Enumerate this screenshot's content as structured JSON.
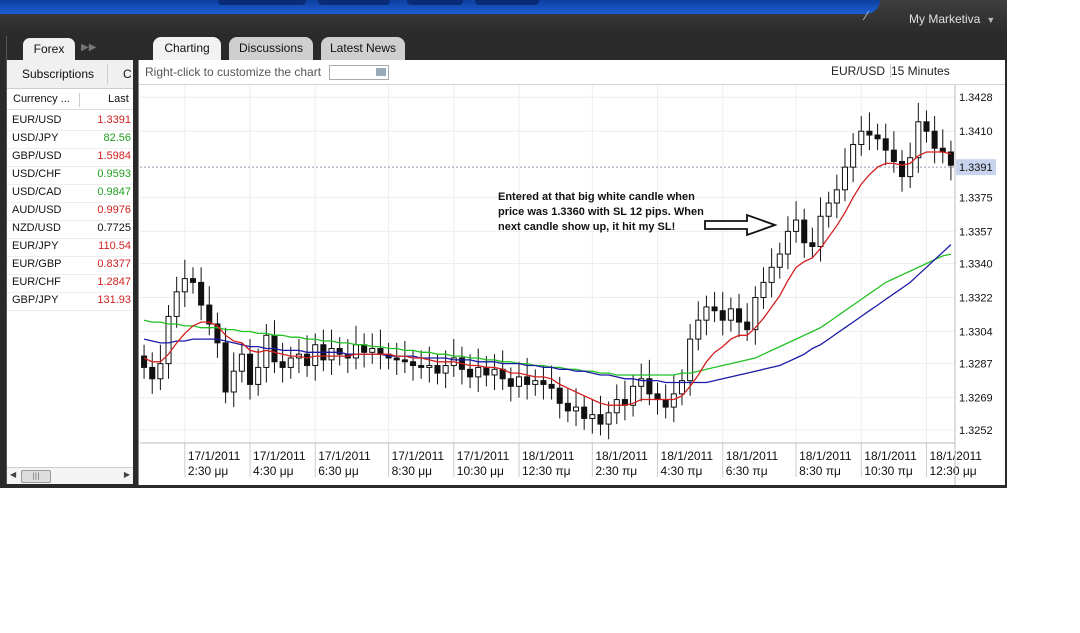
{
  "header": {
    "account_label": "My Marketiva"
  },
  "left_panel": {
    "tab_label": "Forex",
    "subscriptions_label": "Subscriptions",
    "subscriptions_more": "C",
    "col_currency": "Currency ...",
    "col_last": "Last",
    "rows": [
      {
        "pair": "EUR/USD",
        "last": "1.3391",
        "color": "#d42020"
      },
      {
        "pair": "USD/JPY",
        "last": "82.56",
        "color": "#22a022"
      },
      {
        "pair": "GBP/USD",
        "last": "1.5984",
        "color": "#d42020"
      },
      {
        "pair": "USD/CHF",
        "last": "0.9593",
        "color": "#22a022"
      },
      {
        "pair": "USD/CAD",
        "last": "0.9847",
        "color": "#22a022"
      },
      {
        "pair": "AUD/USD",
        "last": "0.9976",
        "color": "#d42020"
      },
      {
        "pair": "NZD/USD",
        "last": "0.7725",
        "color": "#111111"
      },
      {
        "pair": "EUR/JPY",
        "last": "110.54",
        "color": "#d42020"
      },
      {
        "pair": "EUR/GBP",
        "last": "0.8377",
        "color": "#d42020"
      },
      {
        "pair": "EUR/CHF",
        "last": "1.2847",
        "color": "#d42020"
      },
      {
        "pair": "GBP/JPY",
        "last": "131.93",
        "color": "#d42020"
      }
    ]
  },
  "main_tabs": [
    "Charting",
    "Discussions",
    "Latest News"
  ],
  "chart_toolbar": {
    "hint": "Right-click to customize the chart",
    "symbol": "EUR/USD",
    "timeframe": "15 Minutes"
  },
  "annotation": "Entered at that big white candle when price was 1.3360 with SL 12 pips. When next candle show up, it hit my SL!",
  "chart_data": {
    "type": "candlestick",
    "symbol": "EUR/USD",
    "timeframe": "15 Minutes",
    "current_price": 1.3391,
    "y_ticks": [
      "1.3428",
      "1.3410",
      "1.3375",
      "1.3357",
      "1.3340",
      "1.3322",
      "1.3304",
      "1.3287",
      "1.3269",
      "1.3252"
    ],
    "x_ticks": [
      {
        "date": "17/1/2011",
        "time": "2:30 μμ"
      },
      {
        "date": "17/1/2011",
        "time": "4:30 μμ"
      },
      {
        "date": "17/1/2011",
        "time": "6:30 μμ"
      },
      {
        "date": "17/1/2011",
        "time": "8:30 μμ"
      },
      {
        "date": "17/1/2011",
        "time": "10:30 μμ"
      },
      {
        "date": "18/1/2011",
        "time": "12:30 πμ"
      },
      {
        "date": "18/1/2011",
        "time": "2:30 πμ"
      },
      {
        "date": "18/1/2011",
        "time": "4:30 πμ"
      },
      {
        "date": "18/1/2011",
        "time": "6:30 πμ"
      },
      {
        "date": "18/1/2011",
        "time": "8:30 πμ"
      },
      {
        "date": "18/1/2011",
        "time": "10:30 πμ"
      },
      {
        "date": "18/1/2011",
        "time": "12:30 μμ"
      }
    ],
    "ylim": [
      1.3245,
      1.3435
    ],
    "close": [
      1.3285,
      1.3279,
      1.3287,
      1.3312,
      1.3325,
      1.3332,
      1.333,
      1.3318,
      1.3308,
      1.3298,
      1.3272,
      1.3283,
      1.3292,
      1.3276,
      1.3285,
      1.3302,
      1.3288,
      1.3285,
      1.329,
      1.3292,
      1.3286,
      1.3297,
      1.3289,
      1.3295,
      1.3292,
      1.329,
      1.3297,
      1.3293,
      1.3295,
      1.3292,
      1.329,
      1.3289,
      1.3288,
      1.3286,
      1.3285,
      1.3286,
      1.3282,
      1.3286,
      1.329,
      1.3284,
      1.328,
      1.3285,
      1.3281,
      1.3284,
      1.3279,
      1.3275,
      1.328,
      1.3276,
      1.3278,
      1.3276,
      1.3274,
      1.3266,
      1.3262,
      1.3264,
      1.3258,
      1.326,
      1.3255,
      1.3261,
      1.3268,
      1.3265,
      1.3275,
      1.3279,
      1.3271,
      1.3268,
      1.3264,
      1.3271,
      1.3278,
      1.33,
      1.331,
      1.3317,
      1.3315,
      1.331,
      1.3316,
      1.3309,
      1.3305,
      1.3322,
      1.333,
      1.3338,
      1.3345,
      1.3357,
      1.3363,
      1.3351,
      1.3349,
      1.3365,
      1.3372,
      1.3379,
      1.3391,
      1.3403,
      1.341,
      1.3408,
      1.3406,
      1.34,
      1.3394,
      1.3386,
      1.3396,
      1.3415,
      1.341,
      1.3401,
      1.3399,
      1.3392
    ],
    "ema_red": [
      1.329,
      1.3288,
      1.3288,
      1.3292,
      1.3298,
      1.3303,
      1.3307,
      1.3309,
      1.3309,
      1.3307,
      1.3302,
      1.3299,
      1.3298,
      1.3294,
      1.3293,
      1.3294,
      1.3293,
      1.3292,
      1.3291,
      1.3291,
      1.329,
      1.3291,
      1.3291,
      1.3291,
      1.3291,
      1.3291,
      1.3292,
      1.3292,
      1.3292,
      1.3292,
      1.3292,
      1.3291,
      1.3291,
      1.329,
      1.329,
      1.3289,
      1.3288,
      1.3288,
      1.3288,
      1.3287,
      1.3286,
      1.3286,
      1.3285,
      1.3285,
      1.3284,
      1.3282,
      1.3282,
      1.3281,
      1.328,
      1.328,
      1.3279,
      1.3276,
      1.3274,
      1.3272,
      1.327,
      1.3268,
      1.3266,
      1.3265,
      1.3265,
      1.3265,
      1.3266,
      1.3268,
      1.3268,
      1.3268,
      1.3268,
      1.3268,
      1.327,
      1.3275,
      1.3281,
      1.3288,
      1.3293,
      1.3296,
      1.33,
      1.3302,
      1.3302,
      1.3306,
      1.3311,
      1.3317,
      1.3323,
      1.3331,
      1.3338,
      1.3341,
      1.3343,
      1.3348,
      1.3354,
      1.336,
      1.3367,
      1.3375,
      1.3382,
      1.3387,
      1.3391,
      1.3393,
      1.3393,
      1.3392,
      1.3393,
      1.3397,
      1.3399,
      1.3399,
      1.3399,
      1.3398
    ],
    "sma_blue": [
      1.33,
      1.3299,
      1.3298,
      1.3298,
      1.3299,
      1.3299,
      1.33,
      1.33,
      1.33,
      1.33,
      1.3299,
      1.3298,
      1.3297,
      1.3296,
      1.3296,
      1.3295,
      1.3295,
      1.3294,
      1.3294,
      1.3294,
      1.3293,
      1.3293,
      1.3293,
      1.3293,
      1.3293,
      1.3292,
      1.3292,
      1.3292,
      1.3292,
      1.3292,
      1.3291,
      1.3291,
      1.3291,
      1.3291,
      1.329,
      1.329,
      1.329,
      1.329,
      1.3289,
      1.3289,
      1.3289,
      1.3288,
      1.3288,
      1.3288,
      1.3287,
      1.3287,
      1.3287,
      1.3286,
      1.3286,
      1.3285,
      1.3285,
      1.3284,
      1.3284,
      1.3283,
      1.3283,
      1.3282,
      1.3281,
      1.3281,
      1.328,
      1.3279,
      1.3279,
      1.3278,
      1.3278,
      1.3278,
      1.3277,
      1.3277,
      1.3277,
      1.3277,
      1.3277,
      1.3277,
      1.3278,
      1.3279,
      1.328,
      1.3281,
      1.3282,
      1.3283,
      1.3284,
      1.3285,
      1.3286,
      1.3288,
      1.329,
      1.3292,
      1.3295,
      1.3297,
      1.33,
      1.3303,
      1.3306,
      1.3309,
      1.3312,
      1.3315,
      1.3318,
      1.3321,
      1.3324,
      1.3327,
      1.333,
      1.3334,
      1.3338,
      1.3342,
      1.3346,
      1.335
    ],
    "sma_green": [
      1.331,
      1.3309,
      1.3309,
      1.3308,
      1.3308,
      1.3307,
      1.3307,
      1.3306,
      1.3306,
      1.3306,
      1.3305,
      1.3305,
      1.3304,
      1.3304,
      1.3303,
      1.3303,
      1.3302,
      1.3302,
      1.3301,
      1.3301,
      1.33,
      1.33,
      1.3299,
      1.3299,
      1.3298,
      1.3298,
      1.3297,
      1.3297,
      1.3296,
      1.3296,
      1.3295,
      1.3295,
      1.3294,
      1.3294,
      1.3293,
      1.3293,
      1.3292,
      1.3292,
      1.3291,
      1.3291,
      1.329,
      1.329,
      1.3289,
      1.3289,
      1.3288,
      1.3288,
      1.3287,
      1.3287,
      1.3286,
      1.3286,
      1.3285,
      1.3285,
      1.3284,
      1.3284,
      1.3283,
      1.3283,
      1.3282,
      1.3282,
      1.3281,
      1.3281,
      1.3281,
      1.3281,
      1.3281,
      1.3281,
      1.3281,
      1.3281,
      1.3282,
      1.3282,
      1.3283,
      1.3284,
      1.3285,
      1.3286,
      1.3287,
      1.3288,
      1.3289,
      1.329,
      1.3292,
      1.3294,
      1.3296,
      1.3298,
      1.33,
      1.3302,
      1.3304,
      1.3306,
      1.3309,
      1.3312,
      1.3315,
      1.3318,
      1.3321,
      1.3324,
      1.3327,
      1.333,
      1.3332,
      1.3334,
      1.3336,
      1.3338,
      1.334,
      1.3342,
      1.3344,
      1.3345
    ],
    "colors": {
      "ema_red": "#d42020",
      "sma_blue": "#1a1aa8",
      "sma_green": "#22c022"
    }
  }
}
